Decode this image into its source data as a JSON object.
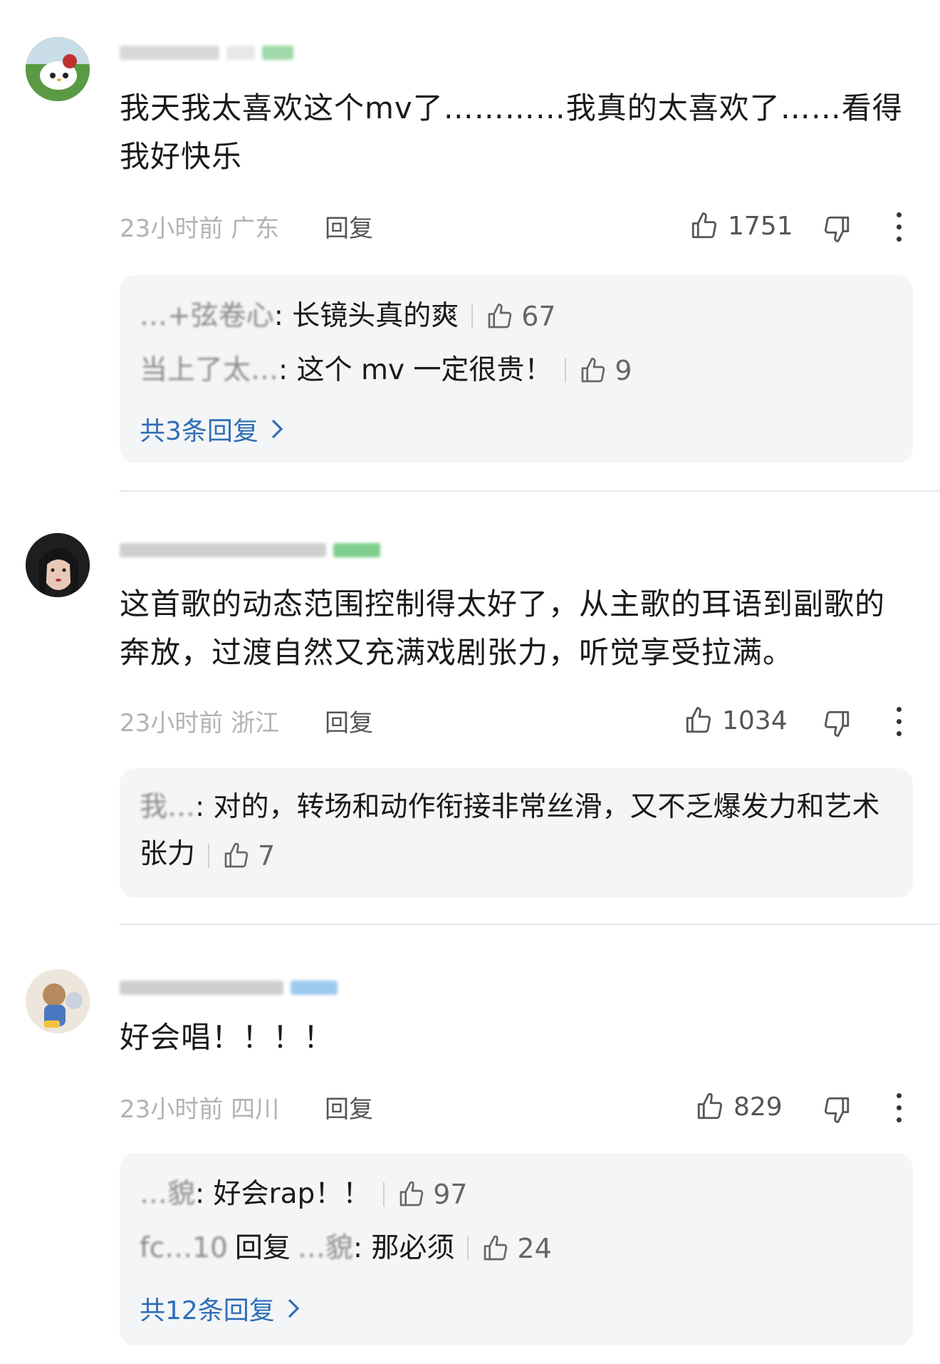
{
  "comments": [
    {
      "text": "我天我太喜欢这个mv了…………我真的太喜欢了……看得我好快乐",
      "time": "23小时前",
      "location": "广东",
      "reply_label": "回复",
      "likes": "1751",
      "replies": [
        {
          "name": "…+弦卷心",
          "text": ": 长镜头真的爽",
          "likes": "67"
        },
        {
          "name": "当上了太…",
          "text": ": 这个 mv 一定很贵！",
          "likes": "9"
        }
      ],
      "more_replies": "共3条回复"
    },
    {
      "text": "这首歌的动态范围控制得太好了，从主歌的耳语到副歌的奔放，过渡自然又充满戏剧张力，听觉享受拉满。",
      "time": "23小时前",
      "location": "浙江",
      "reply_label": "回复",
      "likes": "1034",
      "replies": [
        {
          "name": "我…",
          "text": ": 对的，转场和动作衔接非常丝滑，又不乏爆发力和艺术张力",
          "likes": "7"
        }
      ],
      "more_replies": ""
    },
    {
      "text": "好会唱！！！！",
      "time": "23小时前",
      "location": "四川",
      "reply_label": "回复",
      "likes": "829",
      "replies": [
        {
          "name": "…貌",
          "text": ": 好会rap！！",
          "likes": "97"
        },
        {
          "name": "fc…10",
          "reply_word": "回复",
          "target": "…貌",
          "text": ": 那必须",
          "likes": "24"
        }
      ],
      "more_replies": "共12条回复"
    }
  ],
  "icons": {
    "like": "thumbs-up-icon",
    "dislike": "thumbs-down-icon",
    "more": "more-vertical-icon",
    "chevron": "chevron-right-icon"
  },
  "colors": {
    "link": "#2f6fb6",
    "meta": "#b3b3b3",
    "reply_box": "#f4f5f7"
  }
}
